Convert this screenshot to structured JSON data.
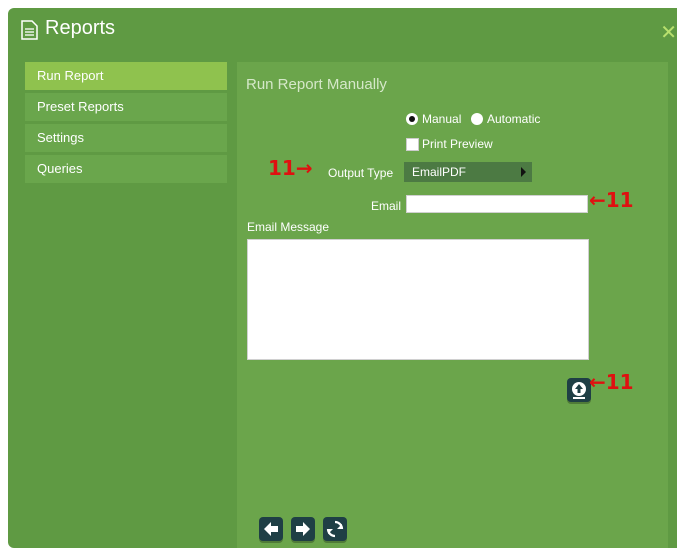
{
  "window": {
    "title": "Reports"
  },
  "sidebar": {
    "items": [
      {
        "label": "Run Report",
        "active": true
      },
      {
        "label": "Preset Reports",
        "active": false
      },
      {
        "label": "Settings",
        "active": false
      },
      {
        "label": "Queries",
        "active": false
      }
    ]
  },
  "main": {
    "heading": "Run Report Manually",
    "mode": {
      "manual_label": "Manual",
      "automatic_label": "Automatic",
      "selected": "Manual"
    },
    "print_preview": {
      "label": "Print Preview",
      "checked": false
    },
    "output_type": {
      "label": "Output Type",
      "value": "EmailPDF"
    },
    "email": {
      "label": "Email",
      "value": ""
    },
    "email_message": {
      "label": "Email Message",
      "value": ""
    }
  },
  "annotations": {
    "output_type_marker": "11→",
    "email_marker": "←11",
    "run_button_marker": "←11"
  },
  "colors": {
    "window_bg": "#5f9a43",
    "panel_bg": "#6ba54b",
    "sidebar_active": "#8fc24e",
    "button_dark": "#1f3f45",
    "annotation_red": "#e01010"
  },
  "icons": {
    "title": "document-icon",
    "close": "close-icon",
    "run": "upload-icon",
    "back": "arrow-left-icon",
    "forward": "arrow-right-icon",
    "refresh": "refresh-icon"
  }
}
